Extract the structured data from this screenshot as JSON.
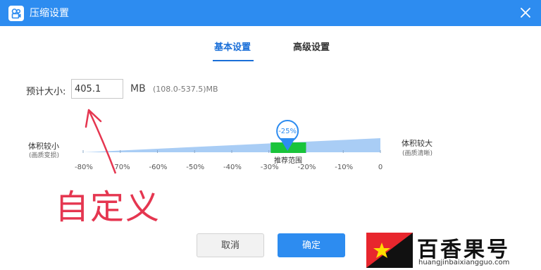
{
  "window": {
    "title": "压缩设置",
    "app_icon": "camera-icon",
    "close_icon": "close-icon"
  },
  "tabs": [
    {
      "label": "基本设置",
      "active": true
    },
    {
      "label": "高级设置",
      "active": false
    }
  ],
  "estimate": {
    "label": "预计大小:",
    "value": "405.1",
    "unit": "MB",
    "range": "(108.0-537.5)MB"
  },
  "slider": {
    "left_label": "体积较小",
    "left_sub": "(画质变损)",
    "right_label": "体积较大",
    "right_sub": "(画质清晰)",
    "ticks": [
      "-80%",
      "-70%",
      "-60%",
      "-50%",
      "-40%",
      "-30%",
      "-20%",
      "-10%",
      "0"
    ],
    "current_label": "-25%",
    "current_fraction": 0.6875,
    "recommended_label": "推荐范围",
    "recommended_range_fraction": [
      0.631,
      0.75
    ],
    "colors": {
      "track": "#a9cdf5",
      "recommended": "#19c43a",
      "pin": "#2d8cf0"
    }
  },
  "annotation": {
    "text": "自定义",
    "color": "#e53650"
  },
  "buttons": {
    "cancel": "取消",
    "ok": "确定"
  },
  "watermark": {
    "title": "百香果号",
    "url": "huangjinbaixiangguo.com"
  },
  "colors": {
    "accent": "#2d8cf0",
    "titlebar": "#2d8cf0"
  }
}
